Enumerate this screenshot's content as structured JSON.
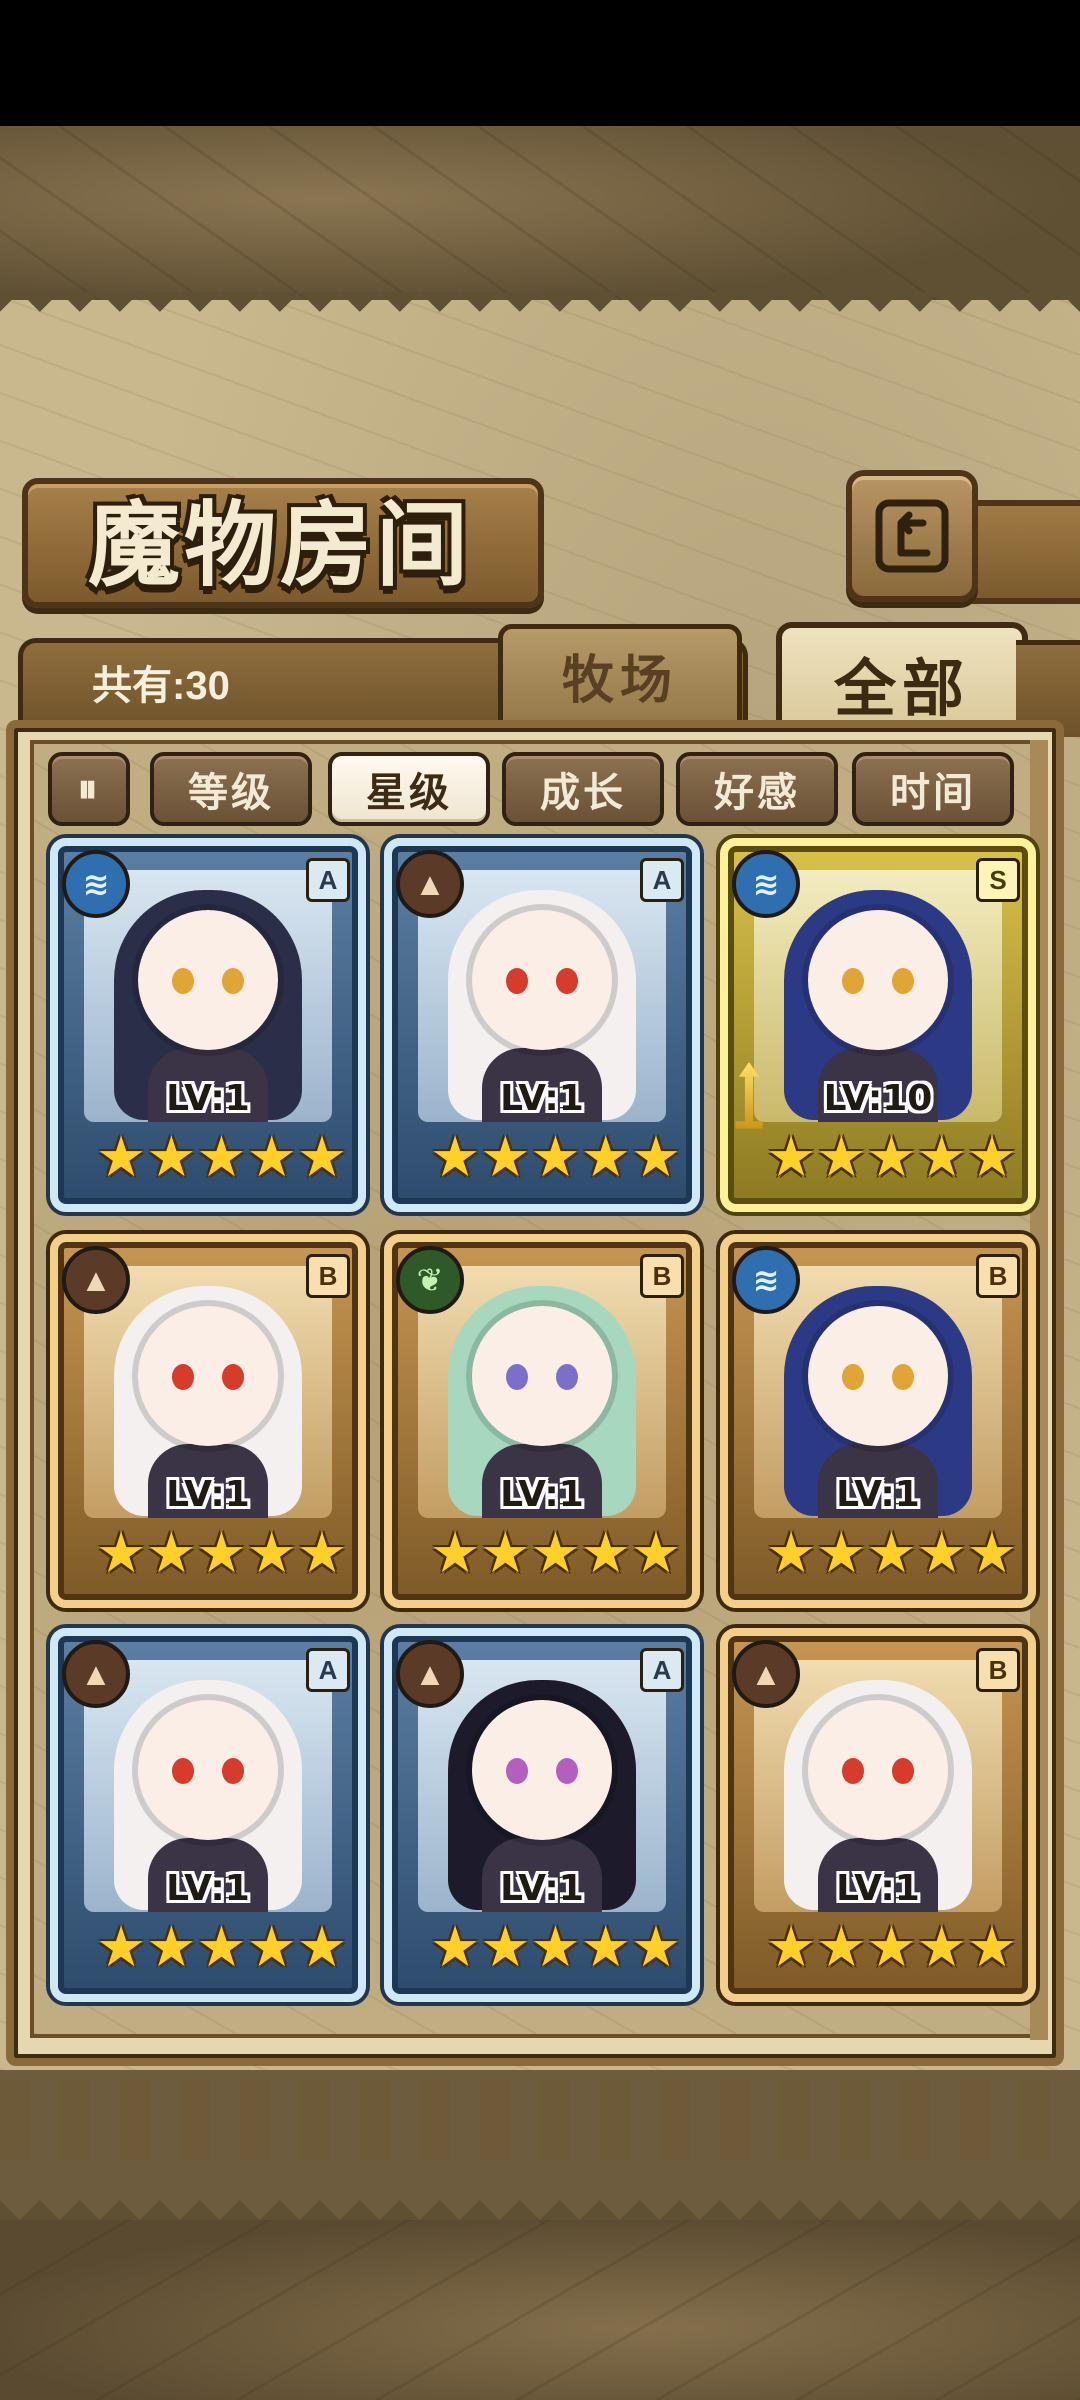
{
  "title": "魔物房间",
  "count_label": "共有:30",
  "tabs": {
    "ranch": "牧场",
    "all": "全部"
  },
  "sort": {
    "toggle_icon": "sort-order-icon",
    "options": [
      "等级",
      "星级",
      "成长",
      "好感",
      "时间"
    ],
    "active": "星级"
  },
  "monsters": [
    {
      "level": "LV:1",
      "rank": "A",
      "element": "water",
      "frame": "blue",
      "stars": 5,
      "hair": "#2b2e48",
      "eyes": "#e0a437"
    },
    {
      "level": "LV:1",
      "rank": "A",
      "element": "earth",
      "frame": "blue",
      "stars": 5,
      "hair": "#f3f0ef",
      "eyes": "#d63b2c"
    },
    {
      "level": "LV:10",
      "rank": "S",
      "element": "water",
      "frame": "gold",
      "stars": 5,
      "hair": "#2c3a86",
      "eyes": "#e0a437"
    },
    {
      "level": "LV:1",
      "rank": "B",
      "element": "earth",
      "frame": "bronze",
      "stars": 5,
      "hair": "#f3f0ef",
      "eyes": "#d63b2c"
    },
    {
      "level": "LV:1",
      "rank": "B",
      "element": "wood",
      "frame": "bronze",
      "stars": 5,
      "hair": "#a7d8be",
      "eyes": "#7b6fc9"
    },
    {
      "level": "LV:1",
      "rank": "B",
      "element": "water",
      "frame": "bronze",
      "stars": 5,
      "hair": "#2c3a86",
      "eyes": "#e0a437"
    },
    {
      "level": "LV:1",
      "rank": "A",
      "element": "earth",
      "frame": "blue",
      "stars": 5,
      "hair": "#f3f0ef",
      "eyes": "#d63b2c"
    },
    {
      "level": "LV:1",
      "rank": "A",
      "element": "earth",
      "frame": "blue",
      "stars": 5,
      "hair": "#1c1a2b",
      "eyes": "#b25fc0"
    },
    {
      "level": "LV:1",
      "rank": "B",
      "element": "earth",
      "frame": "bronze",
      "stars": 5,
      "hair": "#f3f0ef",
      "eyes": "#d63b2c"
    }
  ],
  "element_glyphs": {
    "water": "≋",
    "earth": "▲",
    "wood": "❦"
  },
  "star_glyph": "★"
}
